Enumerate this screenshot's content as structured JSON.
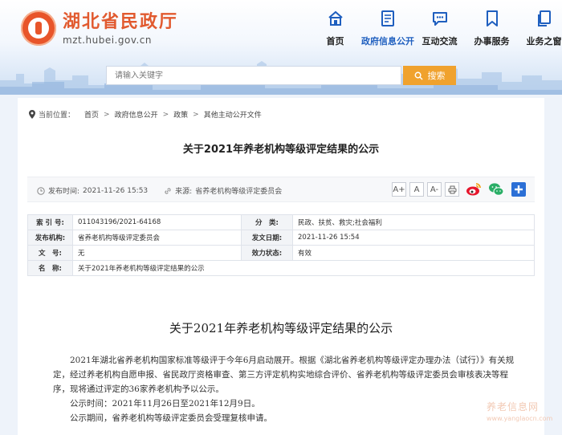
{
  "header": {
    "site_name": "湖北省民政厅",
    "site_url": "mzt.hubei.gov.cn"
  },
  "nav": {
    "items": [
      {
        "label": "首页",
        "icon": "home-icon"
      },
      {
        "label": "政府信息公开",
        "icon": "document-icon",
        "active": true
      },
      {
        "label": "互动交流",
        "icon": "chat-bubble-icon"
      },
      {
        "label": "办事服务",
        "icon": "bookmark-icon"
      },
      {
        "label": "业务之窗",
        "icon": "pages-icon"
      }
    ]
  },
  "search": {
    "placeholder": "请输入关键字",
    "button_label": "搜索"
  },
  "breadcrumb": {
    "prefix": "当前位置：",
    "items": [
      "首页",
      "政府信息公开",
      "政策",
      "其他主动公开文件"
    ],
    "separator": ">"
  },
  "article": {
    "title": "关于2021年养老机构等级评定结果的公示",
    "publish_label": "发布时间:",
    "publish_time": "2021-11-26 15:53",
    "source_label": "来源:",
    "source": "省养老机构等级评定委员会",
    "font_buttons": [
      "A+",
      "A",
      "A-"
    ]
  },
  "info_table": {
    "rows": [
      {
        "l1": "索 引 号:",
        "v1": "011043196/2021-64168",
        "l2": "分　类:",
        "v2": "民政、扶贫、救灾;社会福利"
      },
      {
        "l1": "发布机构:",
        "v1": "省养老机构等级评定委员会",
        "l2": "发文日期:",
        "v2": "2021-11-26 15:54"
      },
      {
        "l1": "文　号:",
        "v1": "无",
        "l2": "效力状态:",
        "v2": "有效"
      },
      {
        "l1": "名　称:",
        "v1": "关于2021年养老机构等级评定结果的公示"
      }
    ]
  },
  "document": {
    "title": "关于2021年养老机构等级评定结果的公示",
    "paragraphs": [
      "2021年湖北省养老机构国家标准等级评于今年6月启动展开。根据《湖北省养老机构等级评定办理办法（试行）》有关规定，经过养老机构自愿申报、省民政厅资格审查、第三方评定机构实地综合评价、省养老机构等级评定委员会审核表决等程序，现将通过评定的36家养老机构予以公示。",
      "公示时间：2021年11月26日至2021年12月9日。",
      "公示期间，省养老机构等级评定委员会受理复核申请。"
    ]
  },
  "watermark": {
    "line1": "养老信息网",
    "line2": "www.yanglaocn.com"
  },
  "colors": {
    "brand": "#e15a2f",
    "nav_active": "#1f5fbf",
    "search_button": "#f0a22e"
  }
}
